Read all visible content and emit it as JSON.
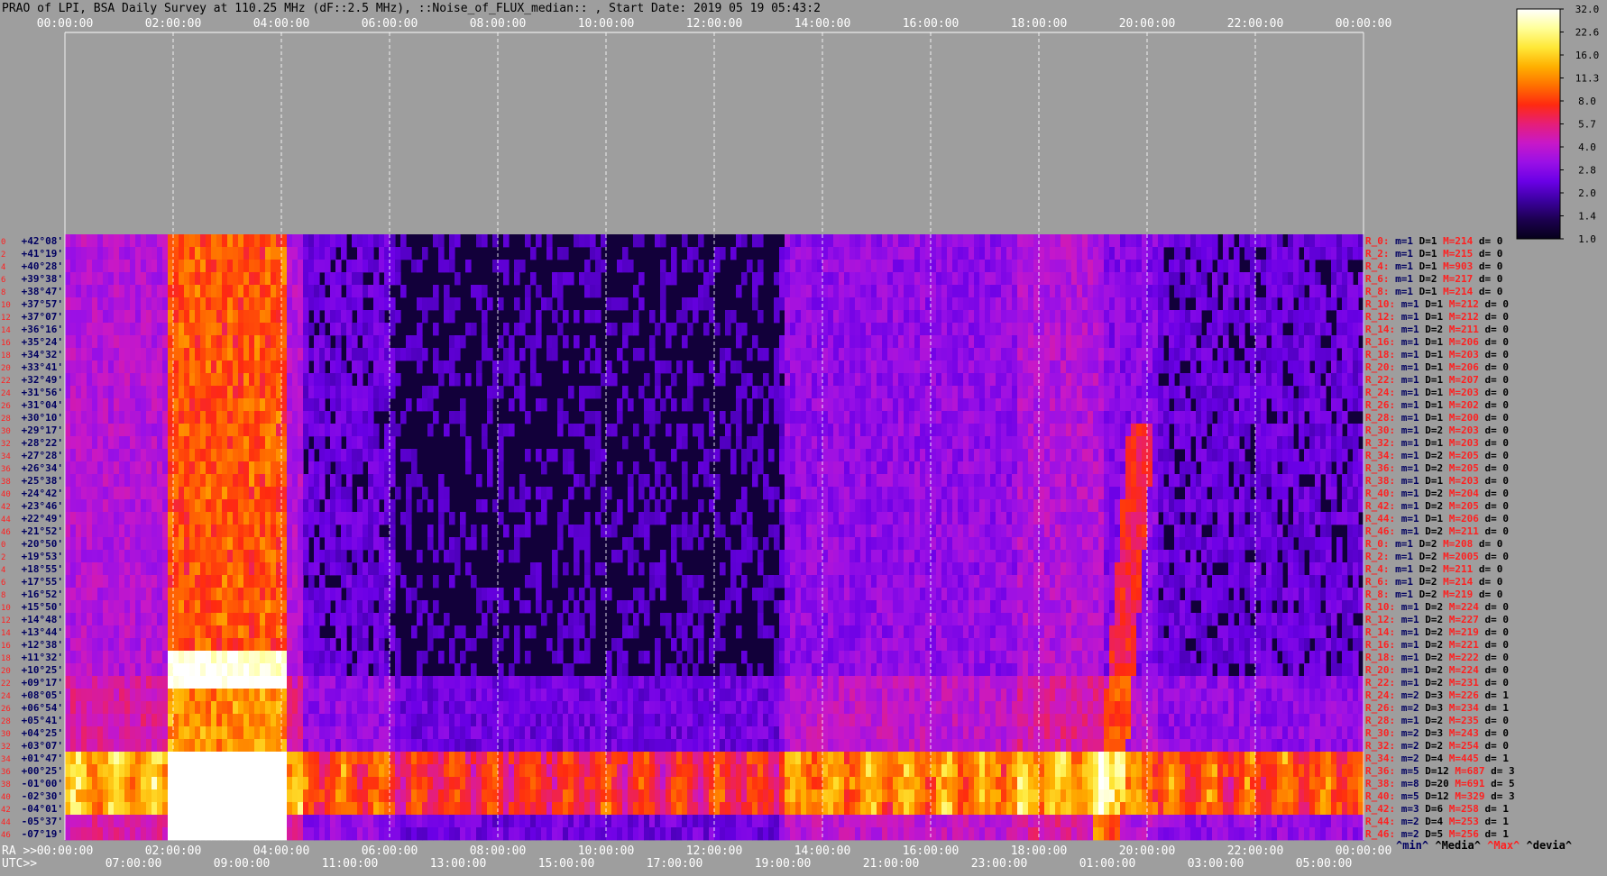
{
  "chart_data": {
    "type": "heatmap",
    "title": "PRAO of LPI, BSA Daily Survey at 110.25 MHz (dF::2.5 MHz), ::Noise_of_FLUX_median:: , Start Date: 2019 05 19 05:43:2",
    "top_time_ticks": [
      "00:00:00",
      "02:00:00",
      "04:00:00",
      "06:00:00",
      "08:00:00",
      "10:00:00",
      "12:00:00",
      "14:00:00",
      "16:00:00",
      "18:00:00",
      "20:00:00",
      "22:00:00",
      "00:00:00"
    ],
    "ra_label": "RA >>",
    "ra_ticks": [
      "00:00:00",
      "02:00:00",
      "04:00:00",
      "06:00:00",
      "08:00:00",
      "10:00:00",
      "12:00:00",
      "14:00:00",
      "16:00:00",
      "18:00:00",
      "20:00:00",
      "22:00:00",
      "00:00:00"
    ],
    "utc_label": "UTC>>",
    "utc_ticks": [
      "07:00:00",
      "09:00:00",
      "11:00:00",
      "13:00:00",
      "15:00:00",
      "17:00:00",
      "19:00:00",
      "21:00:00",
      "23:00:00",
      "01:00:00",
      "03:00:00",
      "05:00:00"
    ],
    "declinations": [
      "+42°08'",
      "+41°19'",
      "+40°28'",
      "+39°38'",
      "+38°47'",
      "+37°57'",
      "+37°07'",
      "+36°16'",
      "+35°24'",
      "+34°32'",
      "+33°41'",
      "+32°49'",
      "+31°56'",
      "+31°04'",
      "+30°10'",
      "+29°17'",
      "+28°22'",
      "+27°28'",
      "+26°34'",
      "+25°38'",
      "+24°42'",
      "+23°46'",
      "+22°49'",
      "+21°52'",
      "+20°50'",
      "+19°53'",
      "+18°55'",
      "+17°55'",
      "+16°52'",
      "+15°50'",
      "+14°48'",
      "+13°44'",
      "+12°38'",
      "+11°32'",
      "+10°25'",
      "+09°17'",
      "+08°05'",
      "+06°54'",
      "+05°41'",
      "+04°25'",
      "+03°07'",
      "+01°47'",
      "+00°25'",
      "-01°00'",
      "-02°30'",
      "-04°01'",
      "-05°37'",
      "-07°19'"
    ],
    "row_index_labels": [
      "0",
      "2",
      "4",
      "6",
      "8",
      "10",
      "12",
      "14",
      "16",
      "18",
      "20",
      "22",
      "24",
      "26",
      "28",
      "30",
      "32",
      "34",
      "36",
      "38",
      "40",
      "42",
      "44",
      "46",
      "0",
      "2",
      "4",
      "6",
      "8",
      "10",
      "12",
      "14",
      "16",
      "18",
      "20",
      "22",
      "24",
      "26",
      "28",
      "30",
      "32",
      "34",
      "36",
      "38",
      "40",
      "42",
      "44",
      "46"
    ],
    "row_stats": [
      {
        "r": "R_0:",
        "m": "m=1",
        "D": "D=1",
        "M": "M=214",
        "d": "d= 0"
      },
      {
        "r": "R_2:",
        "m": "m=1",
        "D": "D=1",
        "M": "M=215",
        "d": "d= 0"
      },
      {
        "r": "R_4:",
        "m": "m=1",
        "D": "D=1",
        "M": "M=903",
        "d": "d= 0"
      },
      {
        "r": "R_6:",
        "m": "m=1",
        "D": "D=2",
        "M": "M=217",
        "d": "d= 0"
      },
      {
        "r": "R_8:",
        "m": "m=1",
        "D": "D=1",
        "M": "M=214",
        "d": "d= 0"
      },
      {
        "r": "R_10:",
        "m": "m=1",
        "D": "D=1",
        "M": "M=212",
        "d": "d= 0"
      },
      {
        "r": "R_12:",
        "m": "m=1",
        "D": "D=1",
        "M": "M=212",
        "d": "d= 0"
      },
      {
        "r": "R_14:",
        "m": "m=1",
        "D": "D=2",
        "M": "M=211",
        "d": "d= 0"
      },
      {
        "r": "R_16:",
        "m": "m=1",
        "D": "D=1",
        "M": "M=206",
        "d": "d= 0"
      },
      {
        "r": "R_18:",
        "m": "m=1",
        "D": "D=1",
        "M": "M=203",
        "d": "d= 0"
      },
      {
        "r": "R_20:",
        "m": "m=1",
        "D": "D=1",
        "M": "M=206",
        "d": "d= 0"
      },
      {
        "r": "R_22:",
        "m": "m=1",
        "D": "D=1",
        "M": "M=207",
        "d": "d= 0"
      },
      {
        "r": "R_24:",
        "m": "m=1",
        "D": "D=1",
        "M": "M=203",
        "d": "d= 0"
      },
      {
        "r": "R_26:",
        "m": "m=1",
        "D": "D=1",
        "M": "M=202",
        "d": "d= 0"
      },
      {
        "r": "R_28:",
        "m": "m=1",
        "D": "D=1",
        "M": "M=200",
        "d": "d= 0"
      },
      {
        "r": "R_30:",
        "m": "m=1",
        "D": "D=2",
        "M": "M=203",
        "d": "d= 0"
      },
      {
        "r": "R_32:",
        "m": "m=1",
        "D": "D=1",
        "M": "M=203",
        "d": "d= 0"
      },
      {
        "r": "R_34:",
        "m": "m=1",
        "D": "D=2",
        "M": "M=205",
        "d": "d= 0"
      },
      {
        "r": "R_36:",
        "m": "m=1",
        "D": "D=2",
        "M": "M=205",
        "d": "d= 0"
      },
      {
        "r": "R_38:",
        "m": "m=1",
        "D": "D=1",
        "M": "M=203",
        "d": "d= 0"
      },
      {
        "r": "R_40:",
        "m": "m=1",
        "D": "D=2",
        "M": "M=204",
        "d": "d= 0"
      },
      {
        "r": "R_42:",
        "m": "m=1",
        "D": "D=2",
        "M": "M=205",
        "d": "d= 0"
      },
      {
        "r": "R_44:",
        "m": "m=1",
        "D": "D=1",
        "M": "M=206",
        "d": "d= 0"
      },
      {
        "r": "R_46:",
        "m": "m=1",
        "D": "D=2",
        "M": "M=211",
        "d": "d= 0"
      },
      {
        "r": "R_0:",
        "m": "m=1",
        "D": "D=2",
        "M": "M=208",
        "d": "d= 0"
      },
      {
        "r": "R_2:",
        "m": "m=1",
        "D": "D=2",
        "M": "M=2005",
        "d": "d= 0"
      },
      {
        "r": "R_4:",
        "m": "m=1",
        "D": "D=2",
        "M": "M=211",
        "d": "d= 0"
      },
      {
        "r": "R_6:",
        "m": "m=1",
        "D": "D=2",
        "M": "M=214",
        "d": "d= 0"
      },
      {
        "r": "R_8:",
        "m": "m=1",
        "D": "D=2",
        "M": "M=219",
        "d": "d= 0"
      },
      {
        "r": "R_10:",
        "m": "m=1",
        "D": "D=2",
        "M": "M=224",
        "d": "d= 0"
      },
      {
        "r": "R_12:",
        "m": "m=1",
        "D": "D=2",
        "M": "M=227",
        "d": "d= 0"
      },
      {
        "r": "R_14:",
        "m": "m=1",
        "D": "D=2",
        "M": "M=219",
        "d": "d= 0"
      },
      {
        "r": "R_16:",
        "m": "m=1",
        "D": "D=2",
        "M": "M=221",
        "d": "d= 0"
      },
      {
        "r": "R_18:",
        "m": "m=1",
        "D": "D=2",
        "M": "M=222",
        "d": "d= 0"
      },
      {
        "r": "R_20:",
        "m": "m=1",
        "D": "D=2",
        "M": "M=224",
        "d": "d= 0"
      },
      {
        "r": "R_22:",
        "m": "m=1",
        "D": "D=2",
        "M": "M=231",
        "d": "d= 0"
      },
      {
        "r": "R_24:",
        "m": "m=2",
        "D": "D=3",
        "M": "M=226",
        "d": "d= 1"
      },
      {
        "r": "R_26:",
        "m": "m=2",
        "D": "D=3",
        "M": "M=234",
        "d": "d= 1"
      },
      {
        "r": "R_28:",
        "m": "m=1",
        "D": "D=2",
        "M": "M=235",
        "d": "d= 0"
      },
      {
        "r": "R_30:",
        "m": "m=2",
        "D": "D=3",
        "M": "M=243",
        "d": "d= 0"
      },
      {
        "r": "R_32:",
        "m": "m=2",
        "D": "D=2",
        "M": "M=254",
        "d": "d= 0"
      },
      {
        "r": "R_34:",
        "m": "m=2",
        "D": "D=4",
        "M": "M=445",
        "d": "d= 1"
      },
      {
        "r": "R_36:",
        "m": "m=5",
        "D": "D=12",
        "M": "M=687",
        "d": "d= 3"
      },
      {
        "r": "R_38:",
        "m": "m=8",
        "D": "D=20",
        "M": "M=691",
        "d": "d= 5"
      },
      {
        "r": "R_40:",
        "m": "m=5",
        "D": "D=12",
        "M": "M=329",
        "d": "d= 3"
      },
      {
        "r": "R_42:",
        "m": "m=3",
        "D": "D=6",
        "M": "M=258",
        "d": "d= 1"
      },
      {
        "r": "R_44:",
        "m": "m=2",
        "D": "D=4",
        "M": "M=253",
        "d": "d= 1"
      },
      {
        "r": "R_46:",
        "m": "m=2",
        "D": "D=5",
        "M": "M=256",
        "d": "d= 1"
      }
    ],
    "legend_keys": [
      "^min^",
      "^Media^",
      "^Max^",
      "^devia^"
    ],
    "colorbar_ticks": [
      "32.0",
      "22.6",
      "16.0",
      "11.3",
      "8.0",
      "5.7",
      "4.0",
      "2.8",
      "2.0",
      "1.4",
      "1.0"
    ],
    "colors": {
      "background": "#9e9e9e",
      "row_stat_red": "#ff2020",
      "row_stat_navy": "#000060",
      "colormap": [
        "#06001a",
        "#1c0050",
        "#3c00a0",
        "#6a00e6",
        "#9a10e6",
        "#c818c8",
        "#e61e78",
        "#ff2a10",
        "#ff7000",
        "#ffb000",
        "#ffe838",
        "#ffff9a",
        "#ffffff"
      ]
    },
    "bright_bands": [
      {
        "ra_range": [
          "01:50:00",
          "04:00:00"
        ],
        "description": "strong source emission"
      },
      {
        "dec_range": [
          "+01°47'",
          "-02°30'"
        ],
        "description": "bright horizontal band across all RA"
      },
      {
        "ra_range": [
          "18:00:00",
          "20:30:00"
        ],
        "description": "diagonal bright streak"
      }
    ]
  }
}
